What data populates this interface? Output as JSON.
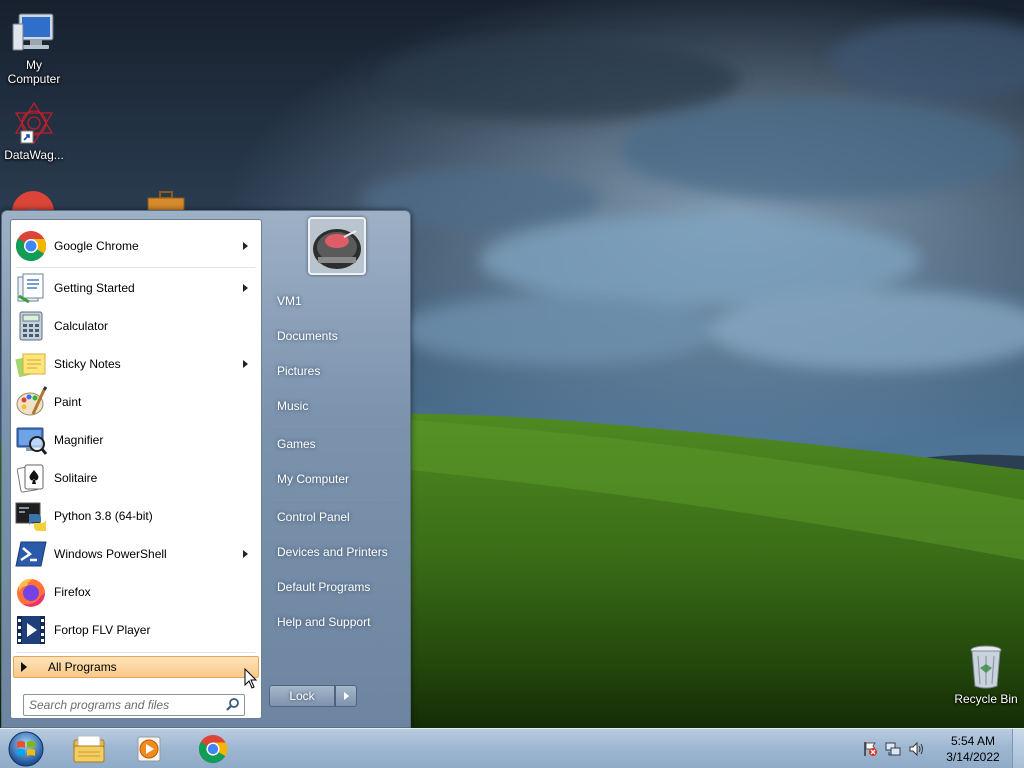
{
  "desktop": {
    "icons": [
      {
        "label": "My\nComputer",
        "icon": "my-computer-icon"
      },
      {
        "label": "DataWag...",
        "icon": "datawag-shortcut-icon"
      },
      {
        "label": "Recycle Bin",
        "icon": "recycle-bin-icon"
      }
    ]
  },
  "start_menu": {
    "programs": [
      {
        "label": "Google Chrome",
        "icon": "chrome-icon",
        "has_submenu": true
      },
      {
        "label": "Getting Started",
        "icon": "getting-started-icon",
        "has_submenu": true
      },
      {
        "label": "Calculator",
        "icon": "calculator-icon",
        "has_submenu": false
      },
      {
        "label": "Sticky Notes",
        "icon": "sticky-notes-icon",
        "has_submenu": true
      },
      {
        "label": "Paint",
        "icon": "paint-icon",
        "has_submenu": false
      },
      {
        "label": "Magnifier",
        "icon": "magnifier-icon",
        "has_submenu": false
      },
      {
        "label": "Solitaire",
        "icon": "solitaire-icon",
        "has_submenu": false
      },
      {
        "label": "Python 3.8 (64-bit)",
        "icon": "python-icon",
        "has_submenu": false
      },
      {
        "label": "Windows PowerShell",
        "icon": "powershell-icon",
        "has_submenu": true
      },
      {
        "label": "Firefox",
        "icon": "firefox-icon",
        "has_submenu": false
      },
      {
        "label": "Fortop FLV Player",
        "icon": "flv-player-icon",
        "has_submenu": false
      }
    ],
    "all_programs_label": "All Programs",
    "search": {
      "placeholder": "Search programs and files",
      "value": ""
    },
    "user_tile_icon": "user-picture-icon",
    "right_items": [
      {
        "label": "VM1"
      },
      {
        "label": "Documents"
      },
      {
        "label": "Pictures"
      },
      {
        "label": "Music"
      },
      {
        "label": "Games"
      },
      {
        "label": "My Computer"
      },
      {
        "label": "Control Panel"
      },
      {
        "label": "Devices and Printers"
      },
      {
        "label": "Default Programs"
      },
      {
        "label": "Help and Support"
      }
    ],
    "lock_label": "Lock"
  },
  "taskbar": {
    "pinned": [
      {
        "name": "windows-explorer",
        "icon": "folder-icon"
      },
      {
        "name": "media-player",
        "icon": "media-player-icon"
      },
      {
        "name": "google-chrome",
        "icon": "chrome-icon"
      }
    ],
    "tray_icons": [
      "action-center-flag-icon",
      "network-icon",
      "volume-icon"
    ],
    "clock": {
      "time": "5:54 AM",
      "date": "3/14/2022"
    }
  },
  "colors": {
    "start_menu_accent": "#7c93ad",
    "all_programs_highlight": "#f9c98a",
    "taskbar": "#9fb8d2"
  }
}
